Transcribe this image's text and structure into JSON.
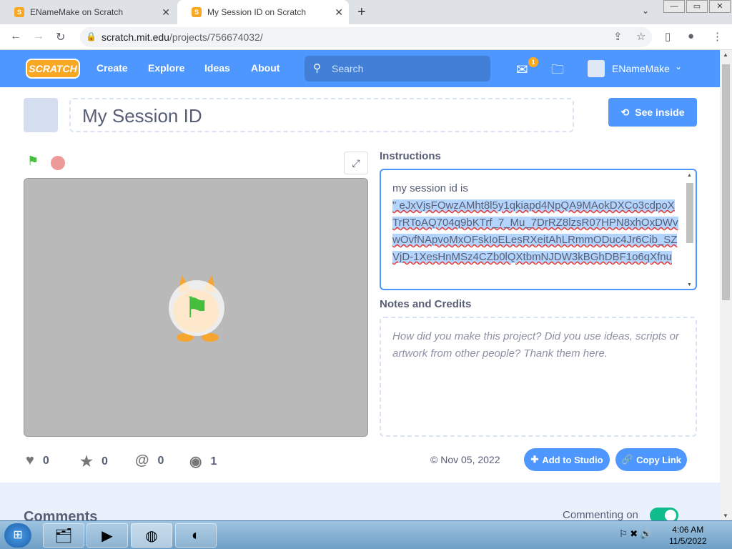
{
  "browser": {
    "tabs": [
      {
        "title": "ENameMake on Scratch"
      },
      {
        "title": "My Session ID on Scratch"
      }
    ],
    "new_tab": "+",
    "url_host": "scratch.mit.edu",
    "url_path": "/projects/756674032/"
  },
  "navbar": {
    "logo": "SCRATCH",
    "links": [
      "Create",
      "Explore",
      "Ideas",
      "About"
    ],
    "search_placeholder": "Search",
    "message_count": "1",
    "username": "ENameMake"
  },
  "project": {
    "title": "My Session ID",
    "see_inside": "See inside",
    "instructions_heading": "Instructions",
    "instructions_line1": "my session id is",
    "instructions_selected": "\" eJxVjsFOwzAMht8l5y1qkiapd4NpQA9MAokDXCo3cdpoXTrRToAQ704q9bKTrf_7_Mu_7DrRZ8lzsR07HPN8xhOxDWvwOvfNApvoMxOFskIoELesRXeitAhLRmmODuc4Jr6Cib_SZVjD-1XesHnMSz4CZb0lQXtbmNJDW3kBGhDBF1o6qXfnu",
    "notes_heading": "Notes and Credits",
    "notes_placeholder": "How did you make this project? Did you use ideas, scripts or artwork from other people? Thank them here.",
    "stats": {
      "loves": "0",
      "favorites": "0",
      "remixes": "0",
      "views": "1"
    },
    "date": "© Nov 05, 2022",
    "add_to_studio": "Add to Studio",
    "copy_link": "Copy Link",
    "comments_heading": "Comments",
    "commenting": "Commenting on"
  },
  "taskbar": {
    "time": "4:06 AM",
    "date": "11/5/2022"
  }
}
